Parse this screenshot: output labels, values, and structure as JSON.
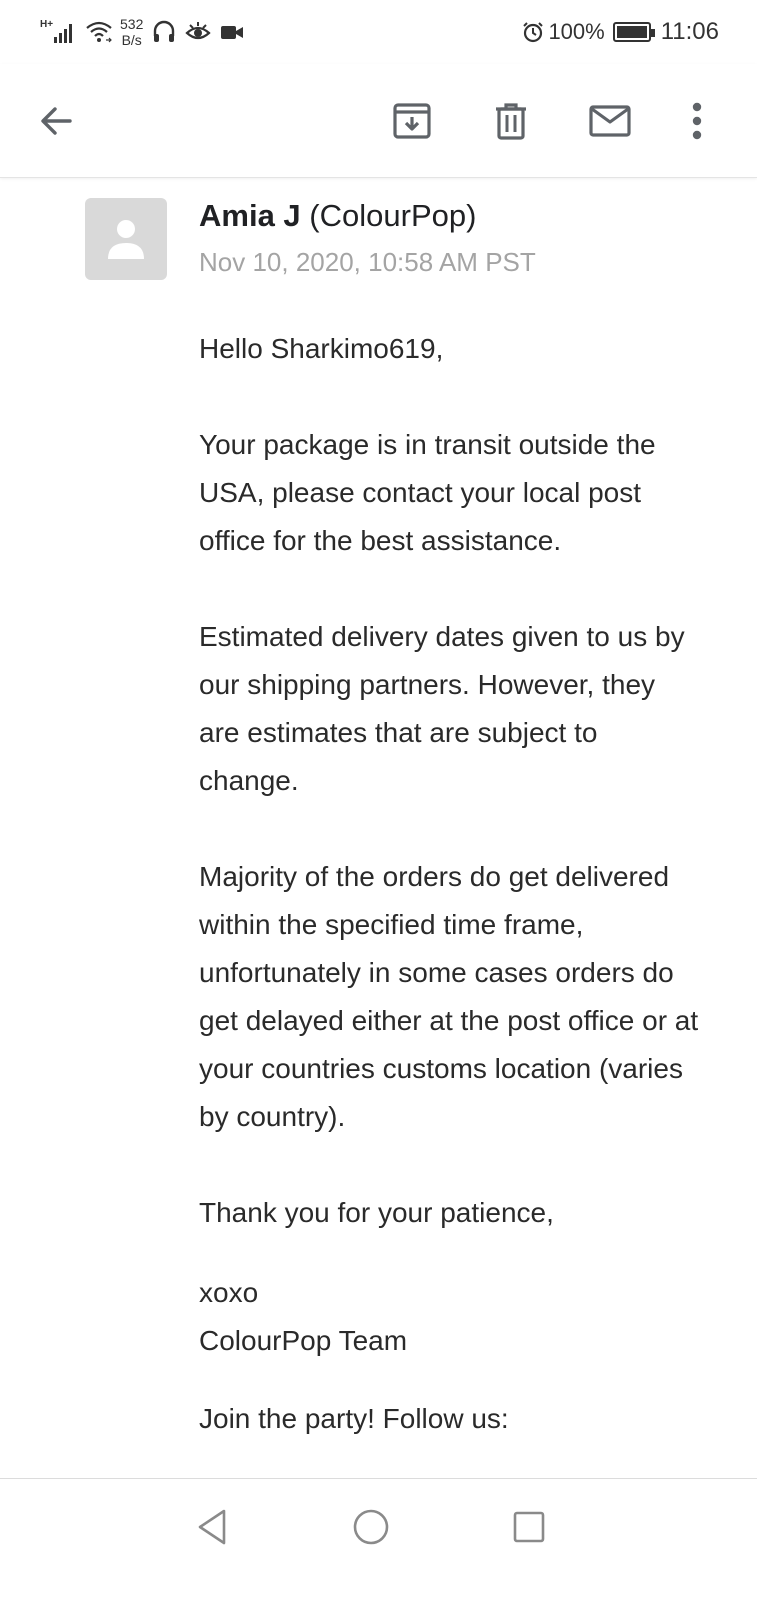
{
  "status_bar": {
    "network_type": "H+",
    "net_speed_value": "532",
    "net_speed_unit": "B/s",
    "battery_percent": "100%",
    "time": "11:06"
  },
  "toolbar": {
    "icons": [
      "back-arrow-icon",
      "archive-icon",
      "trash-icon",
      "mail-icon",
      "more-vert-icon"
    ]
  },
  "email": {
    "sender_name": "Amia J",
    "sender_org": "(ColourPop)",
    "date": "Nov 10, 2020, 10:58 AM PST",
    "greeting": "Hello Sharkimo619,",
    "paragraph_1": "Your package is in transit outside the USA, please contact your local post office for the best assistance.",
    "paragraph_2": "Estimated delivery dates given to us by our shipping partners. However, they are estimates that are subject to change.",
    "paragraph_3": "Majority of the orders do get delivered within the specified time frame, unfortunately in some cases orders do get delayed either at the post office or at your countries customs location (varies by country).",
    "closing": "Thank you for your patience,",
    "signoff": "xoxo",
    "signature": "ColourPop Team",
    "follow": "Join the party! Follow us:"
  },
  "colors": {
    "icon": "#5f6368",
    "text": "#2a2a2a",
    "muted": "#a4a4a4",
    "avatar_bg": "#d9d9d9"
  }
}
